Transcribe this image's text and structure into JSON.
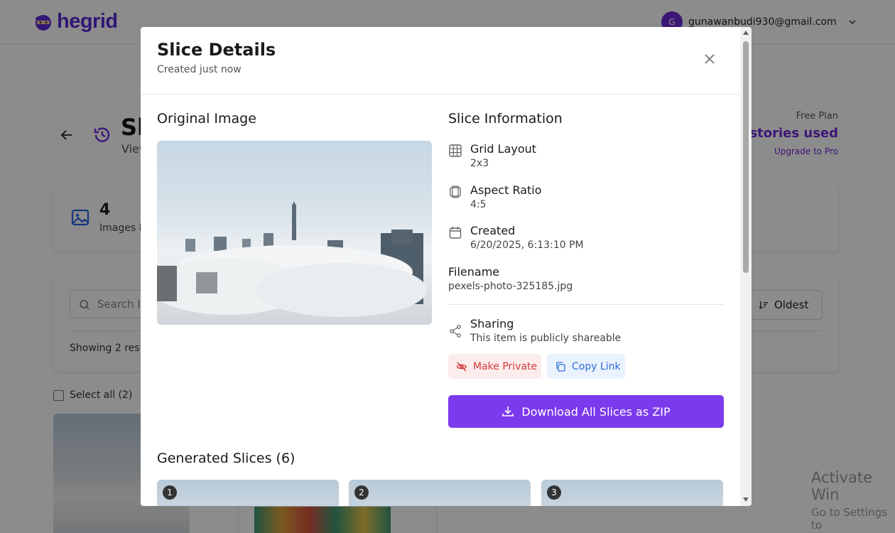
{
  "brand": {
    "name": "hegrid",
    "logo_icon": "ninja-mascot-icon"
  },
  "user": {
    "initial": "G",
    "email": "gunawanbudi930@gmail.com"
  },
  "page": {
    "title": "Sl",
    "subtitle": "View"
  },
  "plan": {
    "label": "Free Plan",
    "usage": "histories used",
    "upgrade": "Upgrade to Pro"
  },
  "stats": {
    "count": "4",
    "label": "Images P"
  },
  "search": {
    "placeholder": "Search I",
    "sort_label": "Oldest",
    "showing": "Showing 2 resu"
  },
  "select_all": "Select all (2)",
  "watermark": {
    "line1": "Activate Win",
    "line2": "Go to Settings to"
  },
  "modal": {
    "title": "Slice Details",
    "subtitle": "Created just now",
    "original_title": "Original Image",
    "info_title": "Slice Information",
    "grid_label": "Grid Layout",
    "grid_value": "2x3",
    "ratio_label": "Aspect Ratio",
    "ratio_value": "4:5",
    "created_label": "Created",
    "created_value": "6/20/2025, 6:13:10 PM",
    "filename_label": "Filename",
    "filename_value": "pexels-photo-325185.jpg",
    "sharing_label": "Sharing",
    "sharing_value": "This item is publicly shareable",
    "make_private": "Make Private",
    "copy_link": "Copy Link",
    "download": "Download All Slices as ZIP",
    "slices_title": "Generated Slices (6)",
    "slices": [
      "1",
      "2",
      "3"
    ]
  },
  "colors": {
    "accent": "#7c3aed",
    "danger": "#d23b3b",
    "link": "#2f6fd6"
  }
}
